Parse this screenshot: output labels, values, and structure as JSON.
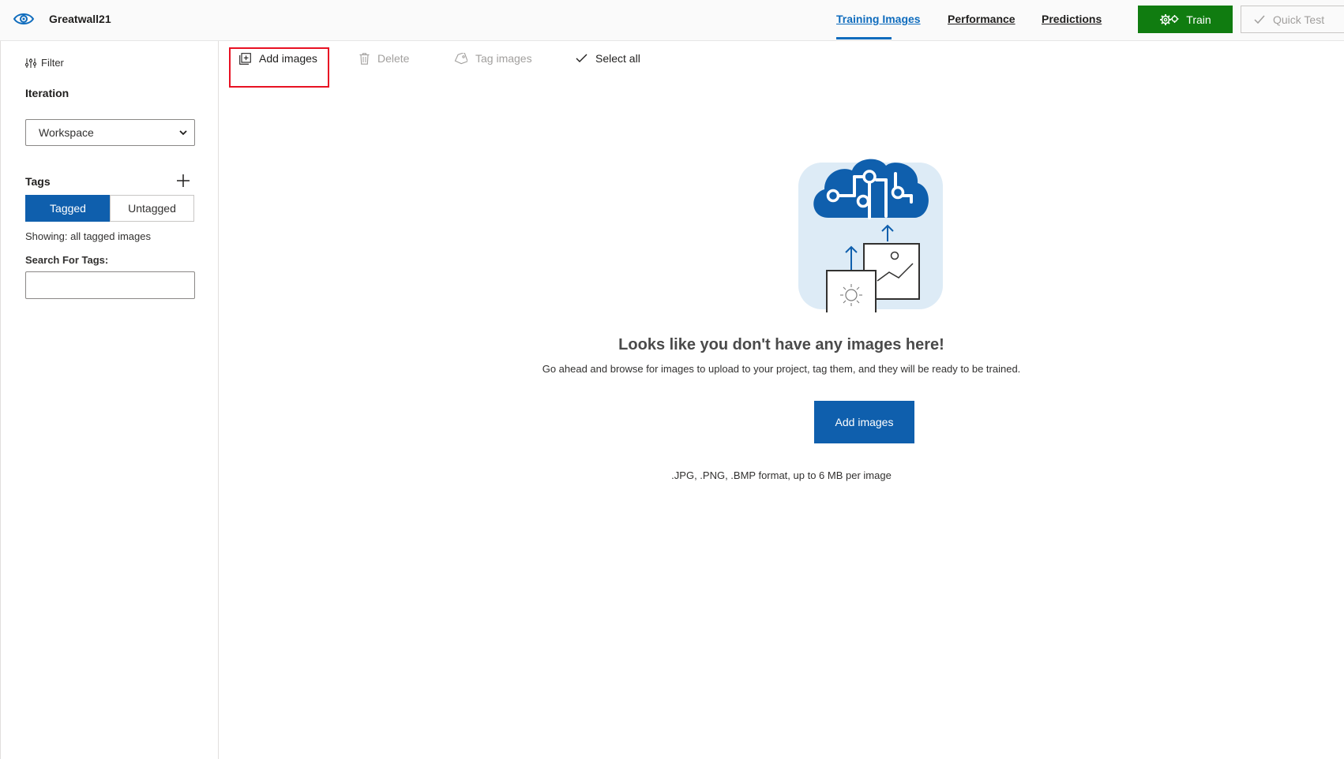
{
  "header": {
    "project_name": "Greatwall21",
    "tabs": [
      {
        "label": "Training Images",
        "active": true
      },
      {
        "label": "Performance",
        "active": false
      },
      {
        "label": "Predictions",
        "active": false
      }
    ],
    "train_label": "Train",
    "quick_test_label": "Quick Test",
    "colors": {
      "accent": "#0f6cbd",
      "train": "#107c10"
    }
  },
  "sidebar": {
    "filter_label": "Filter",
    "iteration_heading": "Iteration",
    "iteration_value": "Workspace",
    "tags_heading": "Tags",
    "tagged_label": "Tagged",
    "untagged_label": "Untagged",
    "showing_text": "Showing: all tagged images",
    "search_label": "Search For Tags:",
    "search_value": ""
  },
  "toolbar": {
    "add_images_label": "Add images",
    "delete_label": "Delete",
    "tag_images_label": "Tag images",
    "select_all_label": "Select all"
  },
  "empty_state": {
    "title": "Looks like you don't have any images here!",
    "description": "Go ahead and browse for images to upload to your project, tag them, and they will be ready to be trained.",
    "button_label": "Add images",
    "formats_text": ".JPG, .PNG, .BMP format, up to 6 MB per image"
  }
}
